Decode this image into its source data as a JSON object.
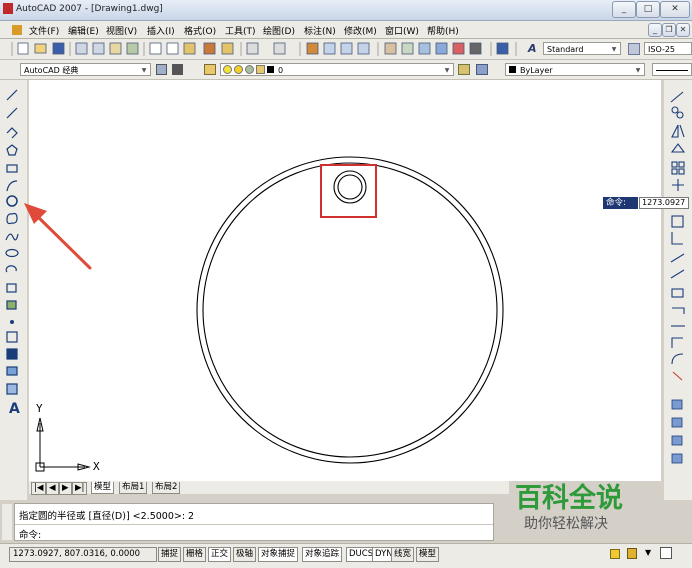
{
  "window": {
    "title": "AutoCAD 2007 - [Drawing1.dwg]",
    "btn_min": "_",
    "btn_max": "□",
    "btn_close": "✕"
  },
  "menu": [
    "文件(F)",
    "编辑(E)",
    "视图(V)",
    "插入(I)",
    "格式(O)",
    "工具(T)",
    "绘图(D)",
    "标注(N)",
    "修改(M)",
    "窗口(W)",
    "帮助(H)"
  ],
  "doc_controls": {
    "min": "_",
    "restore": "❐",
    "close": "✕"
  },
  "toolbar1": {
    "text_style": "Standard",
    "dim_style": "ISO-25"
  },
  "toolbar2": {
    "workspace": "AutoCAD 经典",
    "layer": "0",
    "color": "ByLayer"
  },
  "dynamic_input": {
    "label": "命令:",
    "value": "1273.0927"
  },
  "ucs": {
    "y": "Y",
    "x": "X"
  },
  "tabs": [
    "模型",
    "布局1",
    "布局2"
  ],
  "nav_buttons": [
    "|◀",
    "◀",
    "▶",
    "▶|"
  ],
  "command_line": {
    "line1": "指定圆的半径或 [直径(D)] <2.5000>: 2",
    "line2": "命令:"
  },
  "status": {
    "coords": "1273.0927,  807.0316,  0.0000",
    "buttons": [
      "捕捉",
      "栅格",
      "正交",
      "极轴",
      "对象捕捉",
      "对象追踪",
      "DUCS",
      "DYN",
      "线宽",
      "模型"
    ]
  },
  "watermark": {
    "title": "百科全说",
    "subtitle": "助你轻松解决"
  },
  "colors": {
    "highlight": "#d0312d",
    "arrow": "#e04a3a",
    "watermark": "#2e9a3a"
  }
}
